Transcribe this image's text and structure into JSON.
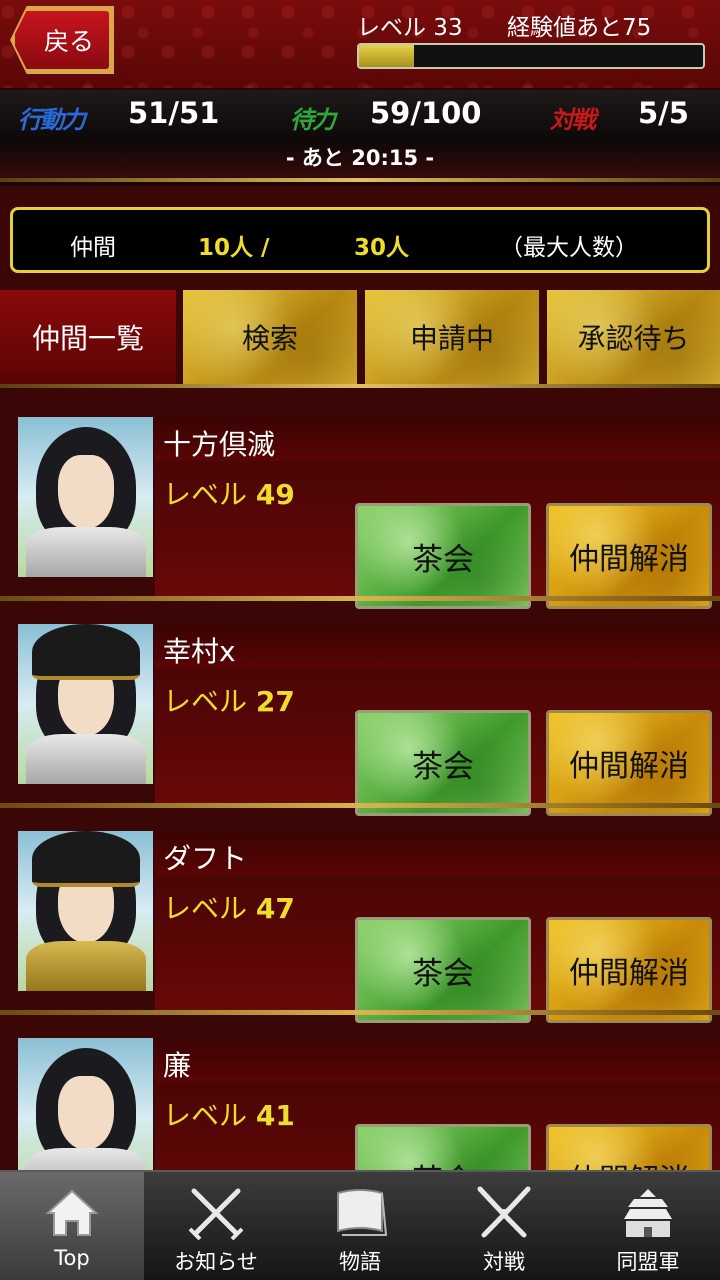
{
  "header": {
    "back_label": "戻る",
    "level_label": "レベル 33",
    "exp_label": "経験値あと75",
    "exp_progress": 0.16
  },
  "stats": {
    "action_label": "行動力",
    "action_value": "51/51",
    "wait_label": "待力",
    "wait_value": "59/100",
    "battle_label": "対戦",
    "battle_value": "5/5",
    "timer": "- あと 20:15 -"
  },
  "friends_count": {
    "label": "仲間",
    "current": "10人 /",
    "max": "30人",
    "note": "（最大人数）"
  },
  "tabs": [
    {
      "label": "仲間一覧"
    },
    {
      "label": "検索"
    },
    {
      "label": "申請中"
    },
    {
      "label": "承認待ち"
    }
  ],
  "friends": [
    {
      "name": "十方倶滅",
      "level_prefix": "レベル",
      "level": "49",
      "tea_label": "茶会",
      "remove_label": "仲間解消"
    },
    {
      "name": "幸村x",
      "level_prefix": "レベル",
      "level": "27",
      "tea_label": "茶会",
      "remove_label": "仲間解消"
    },
    {
      "name": "ダフト",
      "level_prefix": "レベル",
      "level": "47",
      "tea_label": "茶会",
      "remove_label": "仲間解消"
    },
    {
      "name": "廉",
      "level_prefix": "レベル",
      "level": "41",
      "tea_label": "茶会",
      "remove_label": "仲間解消"
    }
  ],
  "nav": [
    {
      "label": "Top",
      "icon": "home-icon"
    },
    {
      "label": "お知らせ",
      "icon": "crossed-swords-icon"
    },
    {
      "label": "物語",
      "icon": "scroll-icon"
    },
    {
      "label": "対戦",
      "icon": "battle-icon"
    },
    {
      "label": "同盟軍",
      "icon": "castle-icon"
    }
  ],
  "colors": {
    "accent_gold": "#e6cf3a",
    "level_yellow": "#f0dc2a",
    "background_red": "#3a0606",
    "action_blue": "#2a6ad8",
    "wait_green": "#2ea83a",
    "battle_red": "#c81818"
  }
}
